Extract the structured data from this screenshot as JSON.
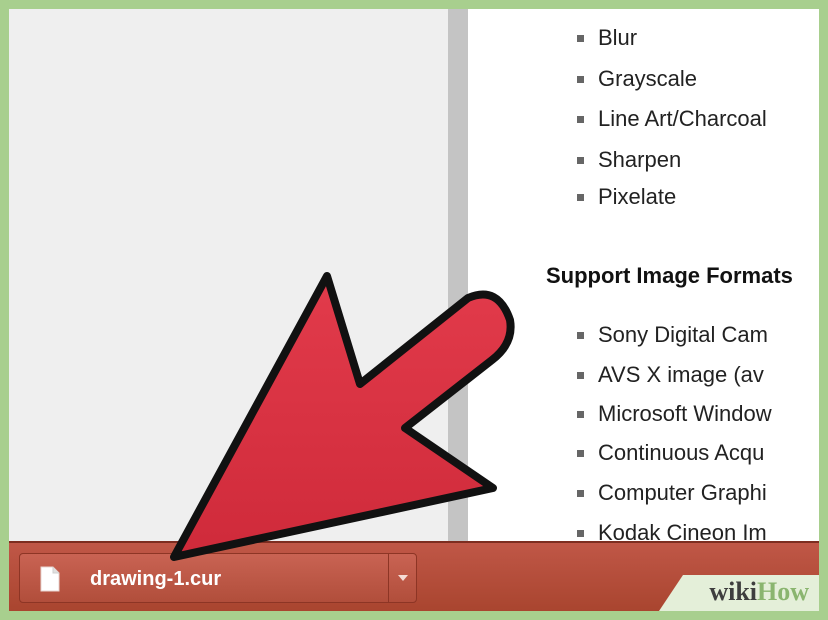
{
  "content": {
    "effects": [
      "Blur",
      "Grayscale",
      "Line Art/Charcoal",
      "Sharpen",
      "Pixelate"
    ],
    "formats_heading": "Support Image Formats",
    "formats": [
      "Sony Digital Cam",
      "AVS X image (av",
      "Microsoft Window",
      "Continuous Acqu",
      "Computer Graphi",
      "Kodak Cineon Im"
    ]
  },
  "download_bar": {
    "file_name": "drawing-1.cur"
  },
  "watermark": {
    "wiki": "wiki",
    "how": "How"
  },
  "colors": {
    "accent_green": "#a8cf8e",
    "download_bar": "#b14e3b",
    "arrow_red": "#dc3242"
  },
  "icons": [
    "file-icon",
    "chevron-down-icon",
    "arrow-pointer-icon"
  ]
}
